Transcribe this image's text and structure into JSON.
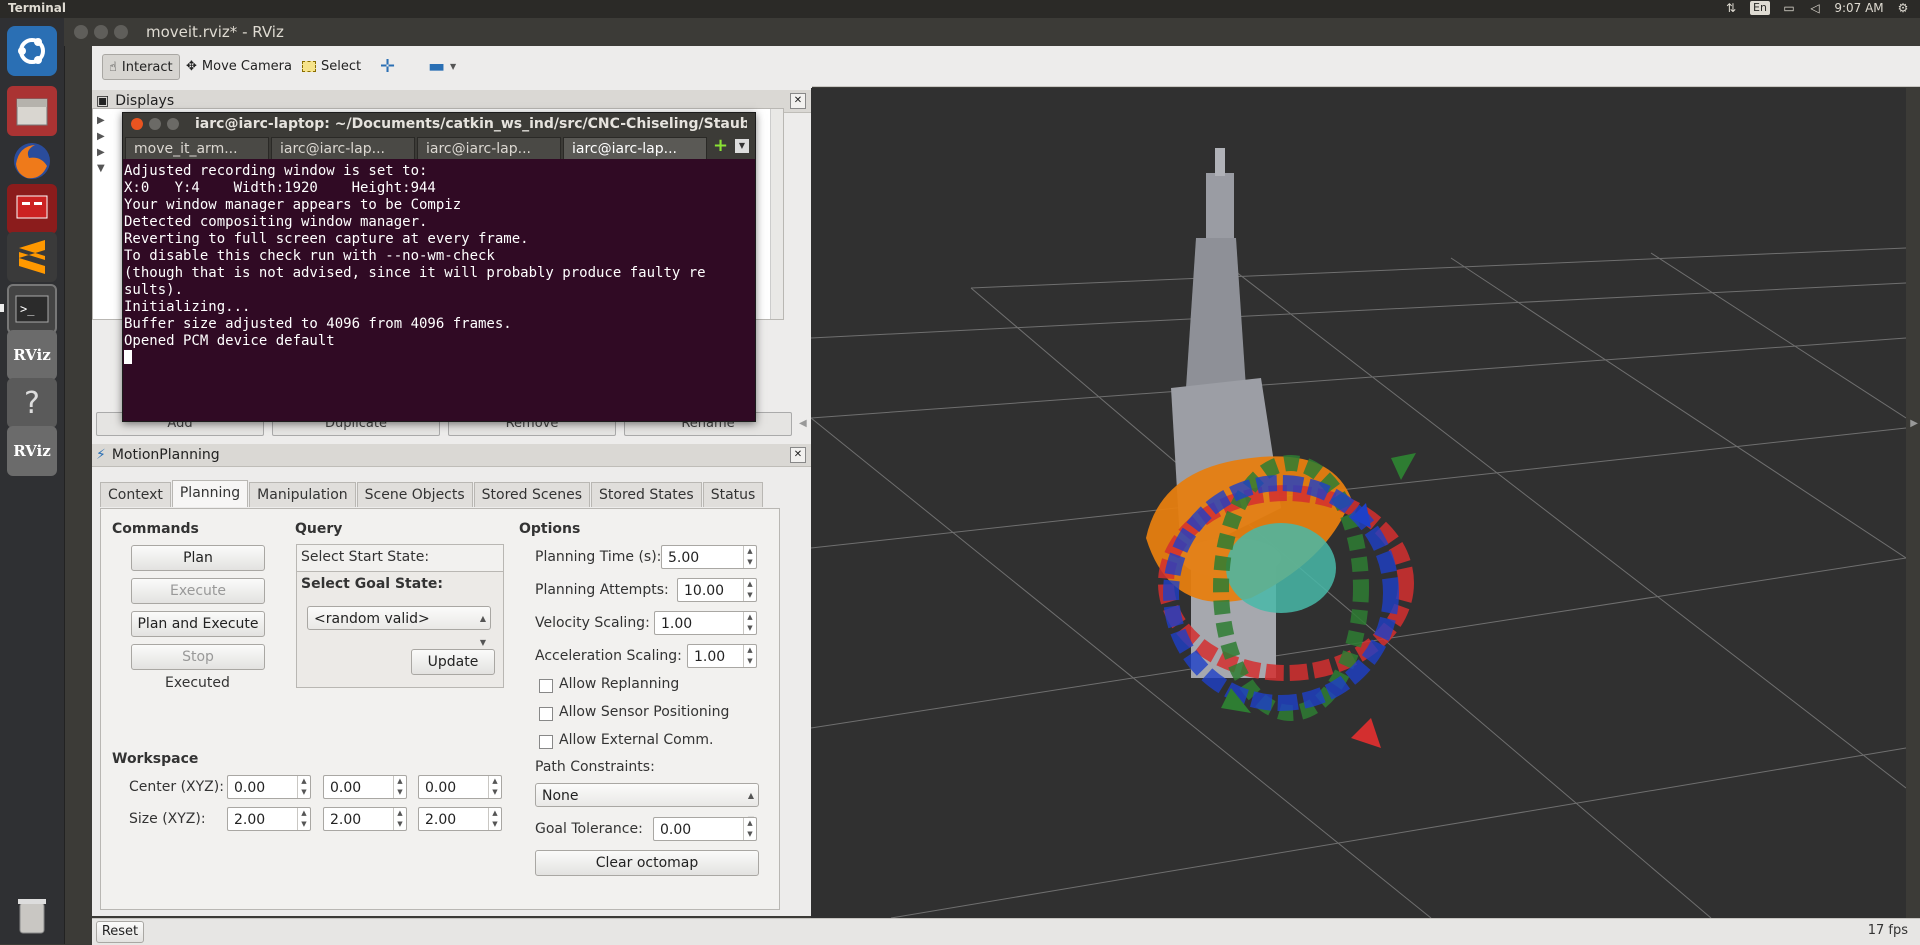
{
  "top_panel": {
    "app_name": "Terminal",
    "keyboard": "En",
    "time": "9:07 AM"
  },
  "launcher": {
    "items": [
      "ubuntu-icon",
      "files-icon",
      "firefox-icon",
      "presentation-icon",
      "sublime-icon",
      "terminal-icon",
      "rviz-icon",
      "unknown-app-icon",
      "rviz-icon",
      "trash-icon"
    ],
    "rviz_label": "RViz",
    "help_label": "?"
  },
  "window": {
    "title": "moveit.rviz* - RViz"
  },
  "toolbar": {
    "interact": "Interact",
    "move_camera": "Move Camera",
    "select": "Select"
  },
  "displays": {
    "title": "Displays",
    "add": "Add",
    "duplicate": "Duplicate",
    "remove": "Remove",
    "rename": "Rename"
  },
  "terminal": {
    "title": "iarc@iarc-laptop: ~/Documents/catkin_ws_ind/src/CNC-Chiseling/StaubliUR",
    "tabs": [
      "move_it_arm...",
      "iarc@iarc-lap...",
      "iarc@iarc-lap...",
      "iarc@iarc-lap..."
    ],
    "lines": [
      "Adjusted recording window is set to:",
      "X:0   Y:4    Width:1920    Height:944",
      "Your window manager appears to be Compiz",
      "",
      "",
      "Detected compositing window manager.",
      "Reverting to full screen capture at every frame.",
      "To disable this check run with --no-wm-check",
      "(though that is not advised, since it will probably produce faulty re",
      "sults).",
      "",
      "Initializing...",
      "Buffer size adjusted to 4096 from 4096 frames.",
      "Opened PCM device default"
    ]
  },
  "motion_planning": {
    "title": "MotionPlanning",
    "tabs": [
      "Context",
      "Planning",
      "Manipulation",
      "Scene Objects",
      "Stored Scenes",
      "Stored States",
      "Status"
    ],
    "selected_tab": "Planning",
    "commands": {
      "heading": "Commands",
      "plan": "Plan",
      "execute": "Execute",
      "plan_and_execute": "Plan and Execute",
      "stop": "Stop",
      "status": "Executed"
    },
    "query": {
      "heading": "Query",
      "start_state": "Select Start State:",
      "goal_state": "Select Goal State:",
      "goal_value": "<random valid>",
      "update": "Update"
    },
    "options": {
      "heading": "Options",
      "planning_time_label": "Planning Time (s):",
      "planning_time": "5.00",
      "planning_attempts_label": "Planning Attempts:",
      "planning_attempts": "10.00",
      "velocity_label": "Velocity Scaling:",
      "velocity": "1.00",
      "accel_label": "Acceleration Scaling:",
      "accel": "1.00",
      "allow_replanning": "Allow Replanning",
      "allow_sensor": "Allow Sensor Positioning",
      "allow_external": "Allow External Comm.",
      "path_constraints_label": "Path Constraints:",
      "path_constraints": "None",
      "goal_tolerance_label": "Goal Tolerance:",
      "goal_tolerance": "0.00",
      "clear_octomap": "Clear octomap"
    },
    "workspace": {
      "heading": "Workspace",
      "center_label": "Center (XYZ):",
      "center": [
        "0.00",
        "0.00",
        "0.00"
      ],
      "size_label": "Size (XYZ):",
      "size": [
        "2.00",
        "2.00",
        "2.00"
      ]
    }
  },
  "status_bar": {
    "reset": "Reset",
    "fps": "17 fps"
  }
}
